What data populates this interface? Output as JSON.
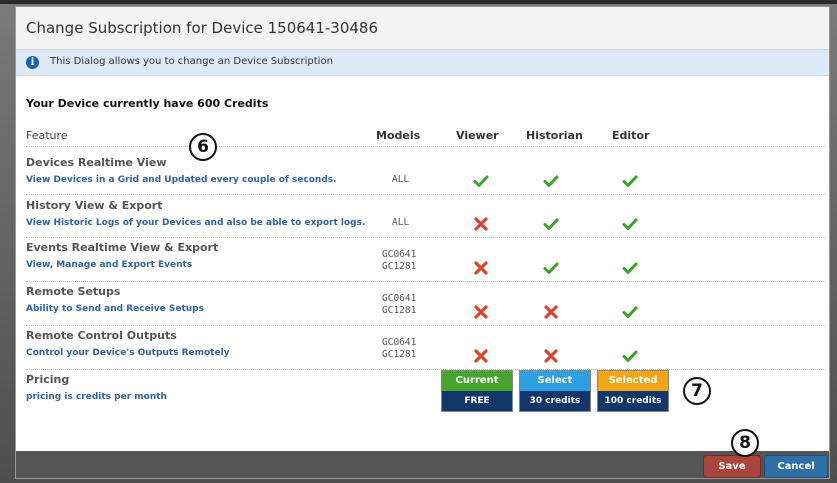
{
  "dialog": {
    "title": "Change Subscription for Device 150641-30486",
    "info": "This Dialog allows you to change an Device Subscription",
    "credits_text": "Your Device currently have 600 Credits"
  },
  "columns": {
    "feature": "Feature",
    "models": "Models",
    "viewer": "Viewer",
    "historian": "Historian",
    "editor": "Editor"
  },
  "features": [
    {
      "title": "Devices Realtime View",
      "desc": "View Devices in a Grid and Updated every couple of seconds.",
      "models": [
        "ALL"
      ],
      "viewer": true,
      "historian": true,
      "editor": true
    },
    {
      "title": "History View & Export",
      "desc": "View Historic Logs of your Devices and also be able to export logs.",
      "models": [
        "ALL"
      ],
      "viewer": false,
      "historian": true,
      "editor": true
    },
    {
      "title": "Events Realtime View & Export",
      "desc": "View, Manage and Export Events",
      "models": [
        "GC0641",
        "GC1281"
      ],
      "viewer": false,
      "historian": true,
      "editor": true
    },
    {
      "title": "Remote Setups",
      "desc": "Ability to Send and Receive Setups",
      "models": [
        "GC0641",
        "GC1281"
      ],
      "viewer": false,
      "historian": false,
      "editor": true
    },
    {
      "title": "Remote Control Outputs",
      "desc": "Control your Device's Outputs Remotely",
      "models": [
        "GC0641",
        "GC1281"
      ],
      "viewer": false,
      "historian": false,
      "editor": true
    }
  ],
  "pricing": {
    "title": "Pricing",
    "desc": "pricing is credits per month",
    "plans": [
      {
        "label": "Current",
        "price": "FREE",
        "color": "#46a52c"
      },
      {
        "label": "Select",
        "price": "30 credits",
        "color": "#2e9fe0"
      },
      {
        "label": "Selected",
        "price": "100 credits",
        "color": "#f2a516"
      }
    ]
  },
  "buttons": {
    "save": "Save",
    "cancel": "Cancel"
  },
  "annotations": [
    "6",
    "7",
    "8"
  ],
  "colors": {
    "check": "#3aa52a",
    "cross": "#d9452b",
    "link": "#2f63a3"
  }
}
